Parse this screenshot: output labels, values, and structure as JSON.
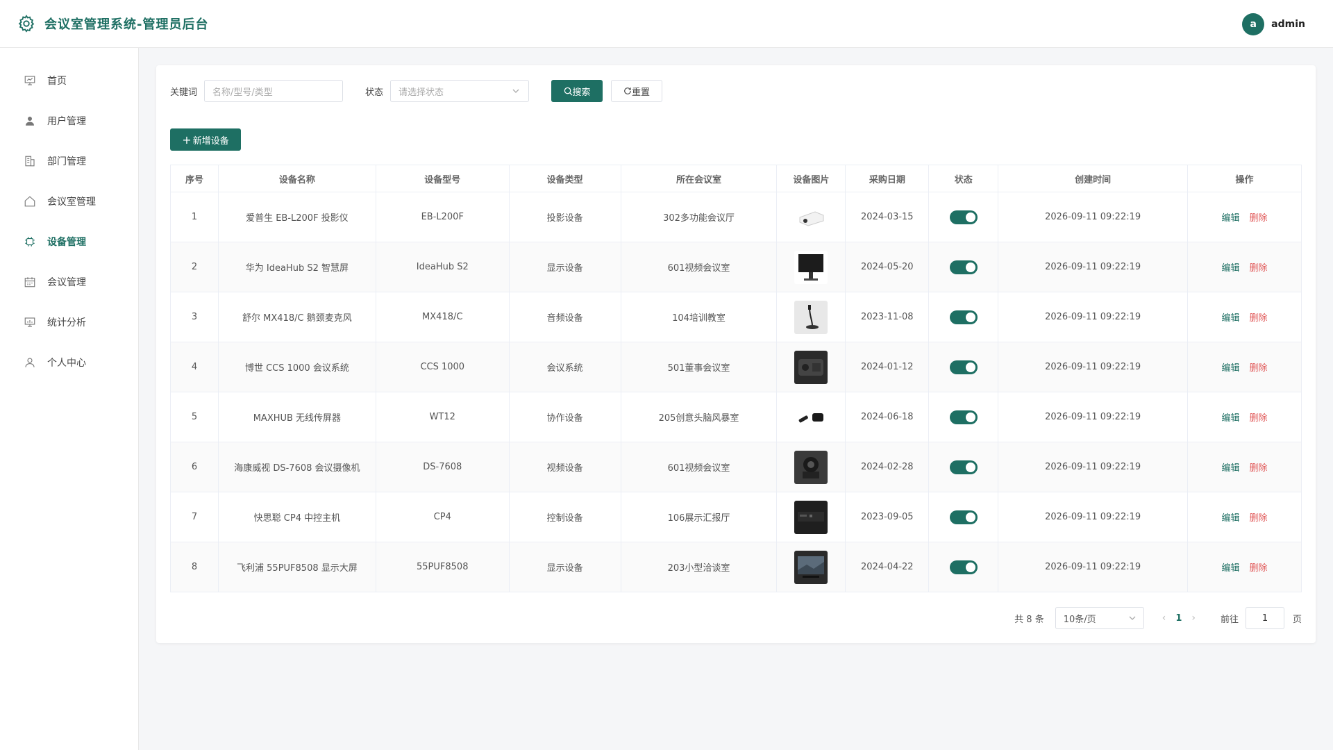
{
  "header": {
    "title": "会议室管理系统-管理员后台",
    "avatar_letter": "a",
    "username": "admin"
  },
  "sidebar": {
    "items": [
      {
        "label": "首页",
        "icon": "presentation-icon",
        "active": false
      },
      {
        "label": "用户管理",
        "icon": "user-icon",
        "active": false
      },
      {
        "label": "部门管理",
        "icon": "building-icon",
        "active": false
      },
      {
        "label": "会议室管理",
        "icon": "home-icon",
        "active": false
      },
      {
        "label": "设备管理",
        "icon": "cpu-icon",
        "active": true
      },
      {
        "label": "会议管理",
        "icon": "calendar-icon",
        "active": false
      },
      {
        "label": "统计分析",
        "icon": "chart-icon",
        "active": false
      },
      {
        "label": "个人中心",
        "icon": "user-outline-icon",
        "active": false
      }
    ]
  },
  "filters": {
    "keyword_label": "关键词",
    "keyword_placeholder": "名称/型号/类型",
    "status_label": "状态",
    "status_placeholder": "请选择状态",
    "search_label": "搜索",
    "reset_label": "重置"
  },
  "add_button_label": "新增设备",
  "table": {
    "headers": [
      "序号",
      "设备名称",
      "设备型号",
      "设备类型",
      "所在会议室",
      "设备图片",
      "采购日期",
      "状态",
      "创建时间",
      "操作"
    ],
    "edit_label": "编辑",
    "delete_label": "删除",
    "rows": [
      {
        "index": "1",
        "name": "爱普生 EB-L200F 投影仪",
        "model": "EB-L200F",
        "type": "投影设备",
        "room": "302多功能会议厅",
        "image": "projector",
        "date": "2024-03-15",
        "enabled": true,
        "created": "2026-09-11 09:22:19"
      },
      {
        "index": "2",
        "name": "华为 IdeaHub S2 智慧屏",
        "model": "IdeaHub S2",
        "type": "显示设备",
        "room": "601视频会议室",
        "image": "smart-screen",
        "date": "2024-05-20",
        "enabled": true,
        "created": "2026-09-11 09:22:19"
      },
      {
        "index": "3",
        "name": "舒尔 MX418/C 鹅颈麦克风",
        "model": "MX418/C",
        "type": "音频设备",
        "room": "104培训教室",
        "image": "microphone",
        "date": "2023-11-08",
        "enabled": true,
        "created": "2026-09-11 09:22:19"
      },
      {
        "index": "4",
        "name": "博世 CCS 1000 会议系统",
        "model": "CCS 1000",
        "type": "会议系统",
        "room": "501董事会议室",
        "image": "conference-unit",
        "date": "2024-01-12",
        "enabled": true,
        "created": "2026-09-11 09:22:19"
      },
      {
        "index": "5",
        "name": "MAXHUB 无线传屏器",
        "model": "WT12",
        "type": "协作设备",
        "room": "205创意头脑风暴室",
        "image": "wireless-dongle",
        "date": "2024-06-18",
        "enabled": true,
        "created": "2026-09-11 09:22:19"
      },
      {
        "index": "6",
        "name": "海康威视 DS-7608 会议摄像机",
        "model": "DS-7608",
        "type": "视频设备",
        "room": "601视频会议室",
        "image": "camera",
        "date": "2024-02-28",
        "enabled": true,
        "created": "2026-09-11 09:22:19"
      },
      {
        "index": "7",
        "name": "快思聪 CP4 中控主机",
        "model": "CP4",
        "type": "控制设备",
        "room": "106展示汇报厅",
        "image": "control-host",
        "date": "2023-09-05",
        "enabled": true,
        "created": "2026-09-11 09:22:19"
      },
      {
        "index": "8",
        "name": "飞利浦 55PUF8508 显示大屏",
        "model": "55PUF8508",
        "type": "显示设备",
        "room": "203小型洽谈室",
        "image": "tv-display",
        "date": "2024-04-22",
        "enabled": true,
        "created": "2026-09-11 09:22:19"
      }
    ]
  },
  "pagination": {
    "total_text": "共 8 条",
    "page_size": "10条/页",
    "current_page": "1",
    "goto_label": "前往",
    "goto_value": "1",
    "page_suffix": "页"
  },
  "colors": {
    "primary": "#1e6f63",
    "danger": "#e05454"
  }
}
